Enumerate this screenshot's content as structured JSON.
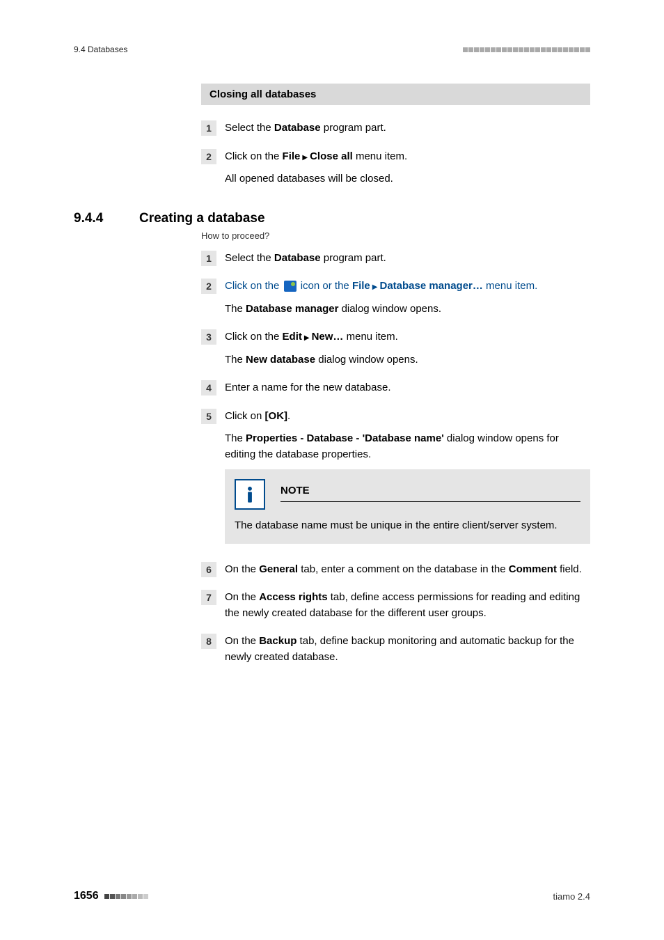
{
  "header": {
    "left": "9.4 Databases"
  },
  "closing": {
    "title": "Closing all databases",
    "steps": [
      {
        "num": "1",
        "lines": [
          {
            "prefix": "Select the ",
            "bold": "Database",
            "suffix": " program part."
          }
        ]
      },
      {
        "num": "2",
        "lines": [
          {
            "prefix": "Click on the ",
            "bold": "File",
            "sep": true,
            "bold2": "Close all",
            "suffix": " menu item."
          },
          {
            "plain": "All opened databases will be closed."
          }
        ]
      }
    ]
  },
  "section": {
    "num": "9.4.4",
    "title": "Creating a database",
    "howto": "How to proceed?"
  },
  "creating": {
    "steps_a": [
      {
        "num": "1",
        "lines": [
          {
            "prefix": "Select the ",
            "bold": "Database",
            "suffix": " program part."
          }
        ]
      },
      {
        "num": "2",
        "linked": true,
        "lines": [
          {
            "icon_line": true,
            "prefix": "Click on the ",
            "mid": " icon or the ",
            "bold": "File",
            "sep": true,
            "bold2": "Database manager…",
            "suffix": " menu item."
          },
          {
            "prefix": "The ",
            "bold": "Database manager",
            "suffix": " dialog window opens."
          }
        ]
      },
      {
        "num": "3",
        "lines": [
          {
            "prefix": "Click on the ",
            "bold": "Edit",
            "sep": true,
            "bold2": "New…",
            "suffix": " menu item."
          },
          {
            "prefix": "The ",
            "bold": "New database",
            "suffix": " dialog window opens."
          }
        ]
      },
      {
        "num": "4",
        "lines": [
          {
            "plain": "Enter a name for the new database."
          }
        ]
      },
      {
        "num": "5",
        "lines": [
          {
            "prefix": "Click on ",
            "bold": "[OK]",
            "suffix": "."
          },
          {
            "prefix": "The ",
            "bold": "Properties - Database - 'Database name'",
            "suffix": " dialog window opens for editing the database properties."
          }
        ],
        "note": {
          "title": "NOTE",
          "text": "The database name must be unique in the entire client/server system."
        }
      }
    ],
    "steps_b": [
      {
        "num": "6",
        "lines": [
          {
            "prefix": "On the ",
            "bold": "General",
            "suffix": " tab, enter a comment on the database in the ",
            "bold2": "Comment",
            "suffix2": " field."
          }
        ]
      },
      {
        "num": "7",
        "lines": [
          {
            "prefix": "On the ",
            "bold": "Access rights",
            "suffix": " tab, define access permissions for reading and editing the newly created database for the different user groups."
          }
        ]
      },
      {
        "num": "8",
        "lines": [
          {
            "prefix": "On the ",
            "bold": "Backup",
            "suffix": " tab, define backup monitoring and automatic backup for the newly created database."
          }
        ]
      }
    ]
  },
  "footer": {
    "page": "1656",
    "right": "tiamo 2.4"
  }
}
